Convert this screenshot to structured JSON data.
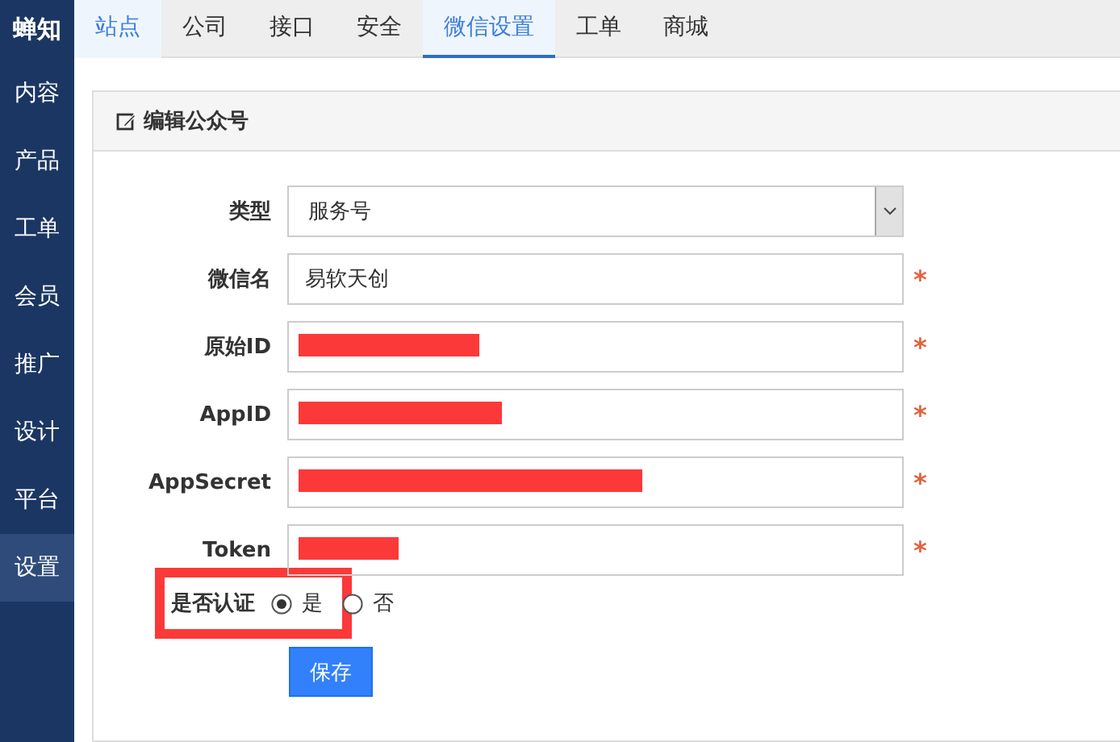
{
  "sidebar": {
    "logo": "蝉知",
    "items": [
      {
        "label": "内容",
        "selected": false
      },
      {
        "label": "产品",
        "selected": false
      },
      {
        "label": "工单",
        "selected": false
      },
      {
        "label": "会员",
        "selected": false
      },
      {
        "label": "推广",
        "selected": false
      },
      {
        "label": "设计",
        "selected": false
      },
      {
        "label": "平台",
        "selected": false
      },
      {
        "label": "设置",
        "selected": true
      }
    ]
  },
  "tabs": [
    {
      "label": "站点",
      "selected": false,
      "hovered": true
    },
    {
      "label": "公司",
      "selected": false,
      "hovered": false
    },
    {
      "label": "接口",
      "selected": false,
      "hovered": false
    },
    {
      "label": "安全",
      "selected": false,
      "hovered": false
    },
    {
      "label": "微信设置",
      "selected": true,
      "hovered": false
    },
    {
      "label": "工单",
      "selected": false,
      "hovered": false
    },
    {
      "label": "商城",
      "selected": false,
      "hovered": false
    }
  ],
  "panel": {
    "title": "编辑公众号",
    "fields": [
      {
        "kind": "select",
        "label": "类型",
        "value": "服务号"
      },
      {
        "kind": "text",
        "label": "微信名",
        "value": "易软天创",
        "required_mark": "*"
      },
      {
        "kind": "text",
        "label": "原始ID",
        "required_mark": "*",
        "redacted": true
      },
      {
        "kind": "text",
        "label": "AppID",
        "required_mark": "*",
        "redacted": true
      },
      {
        "kind": "text",
        "label": "AppSecret",
        "required_mark": "*",
        "redacted": true
      },
      {
        "kind": "text",
        "label": "Token",
        "required_mark": "*",
        "redacted": true
      },
      {
        "kind": "radio",
        "label": "是否认证",
        "highlighted": true,
        "options": [
          {
            "label": "是",
            "selected": true
          },
          {
            "label": "否",
            "selected": false
          }
        ]
      }
    ],
    "save_button": "保存"
  }
}
